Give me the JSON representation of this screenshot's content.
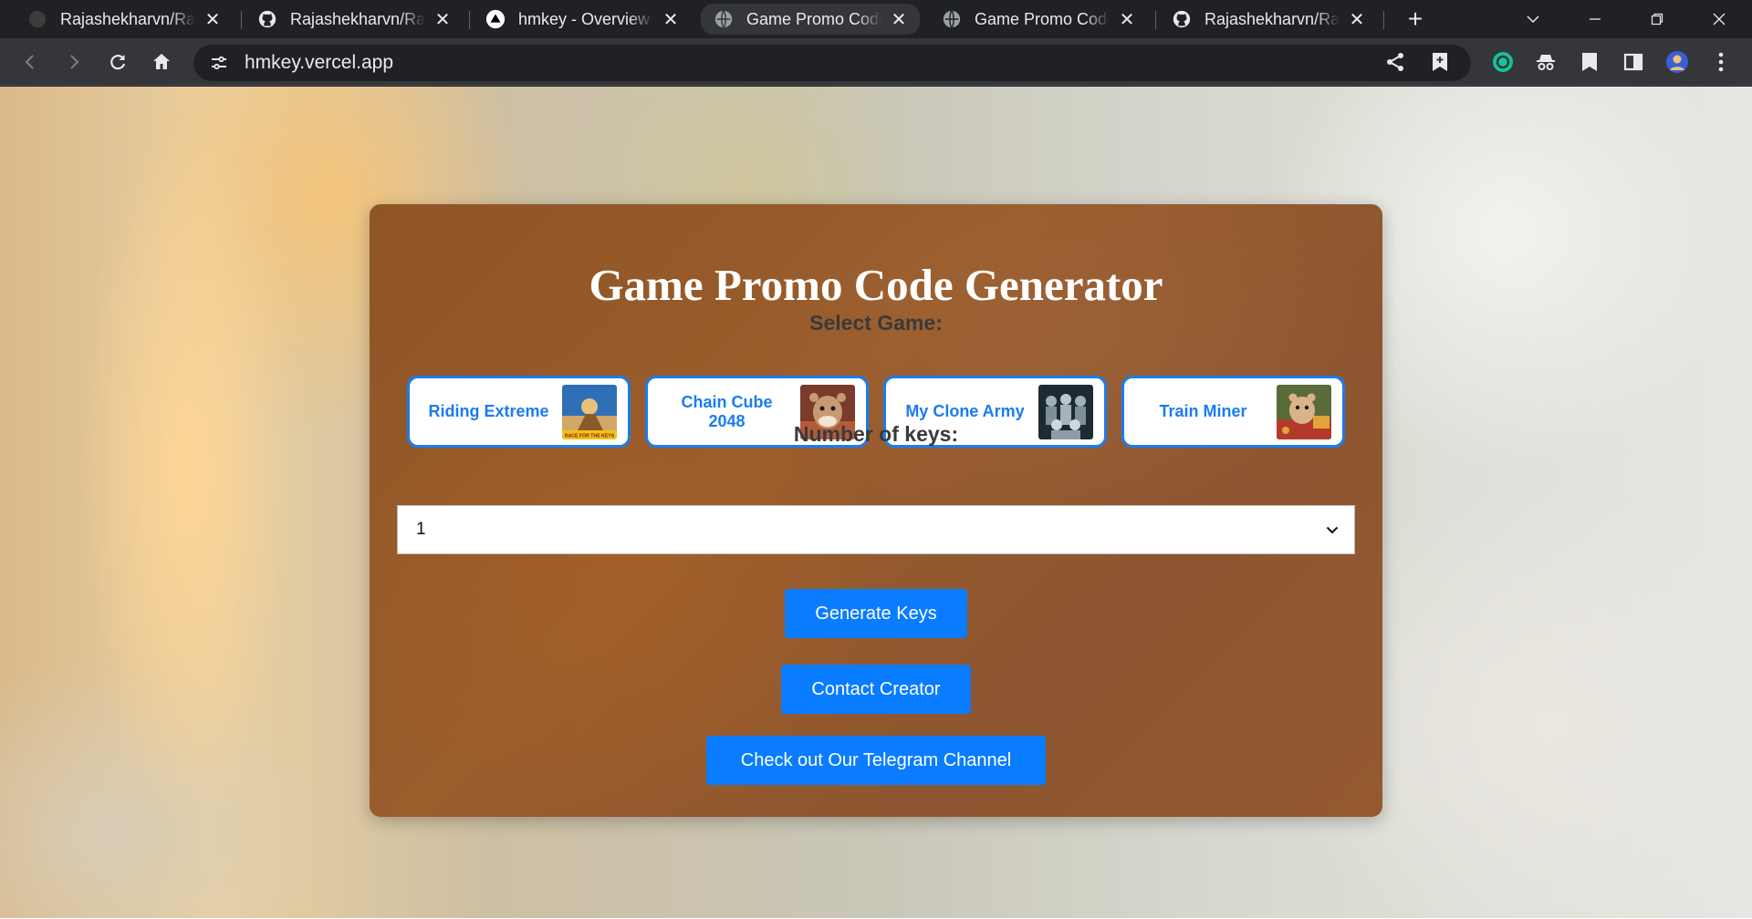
{
  "browser": {
    "tabs": [
      {
        "title": "Rajashekharvn/Raj",
        "icon": "github-icon",
        "active": false
      },
      {
        "title": "Rajashekharvn/Raj",
        "icon": "github-icon",
        "active": false
      },
      {
        "title": "hmkey - Overview",
        "icon": "vercel-icon",
        "active": false
      },
      {
        "title": "Game Promo Code",
        "icon": "globe-icon",
        "active": true
      },
      {
        "title": "Game Promo Code",
        "icon": "globe-icon",
        "active": false
      },
      {
        "title": "Rajashekharvn/Raj",
        "icon": "github-icon",
        "active": false
      }
    ],
    "tab_close_glyph": "✕",
    "new_tab_glyph": "+",
    "url": "hmkey.vercel.app",
    "toolbar_icons": [
      "back-icon",
      "forward-icon",
      "reload-icon",
      "home-icon",
      "site-info-icon",
      "share-icon",
      "bookmark-icon",
      "extension-icon",
      "incognito-icon",
      "reading-list-icon",
      "side-panel-icon",
      "profile-avatar",
      "menu-icon"
    ]
  },
  "page": {
    "title": "Game Promo Code Generator",
    "select_game_label": "Select Game:",
    "games": [
      {
        "name": "Riding Extreme"
      },
      {
        "name": "Chain Cube 2048"
      },
      {
        "name": "My Clone Army"
      },
      {
        "name": "Train Miner"
      }
    ],
    "thumb_text": "RACE FOR THE KEYS",
    "keys_label": "Number of keys:",
    "keys_value": "1",
    "buttons": {
      "generate": "Generate Keys",
      "contact": "Contact Creator",
      "telegram": "Check out Our Telegram Channel"
    },
    "colors": {
      "accent": "#0a7cff",
      "game_border": "#1a7cf0",
      "card": "#94592f",
      "label": "#3a3a3a"
    }
  }
}
